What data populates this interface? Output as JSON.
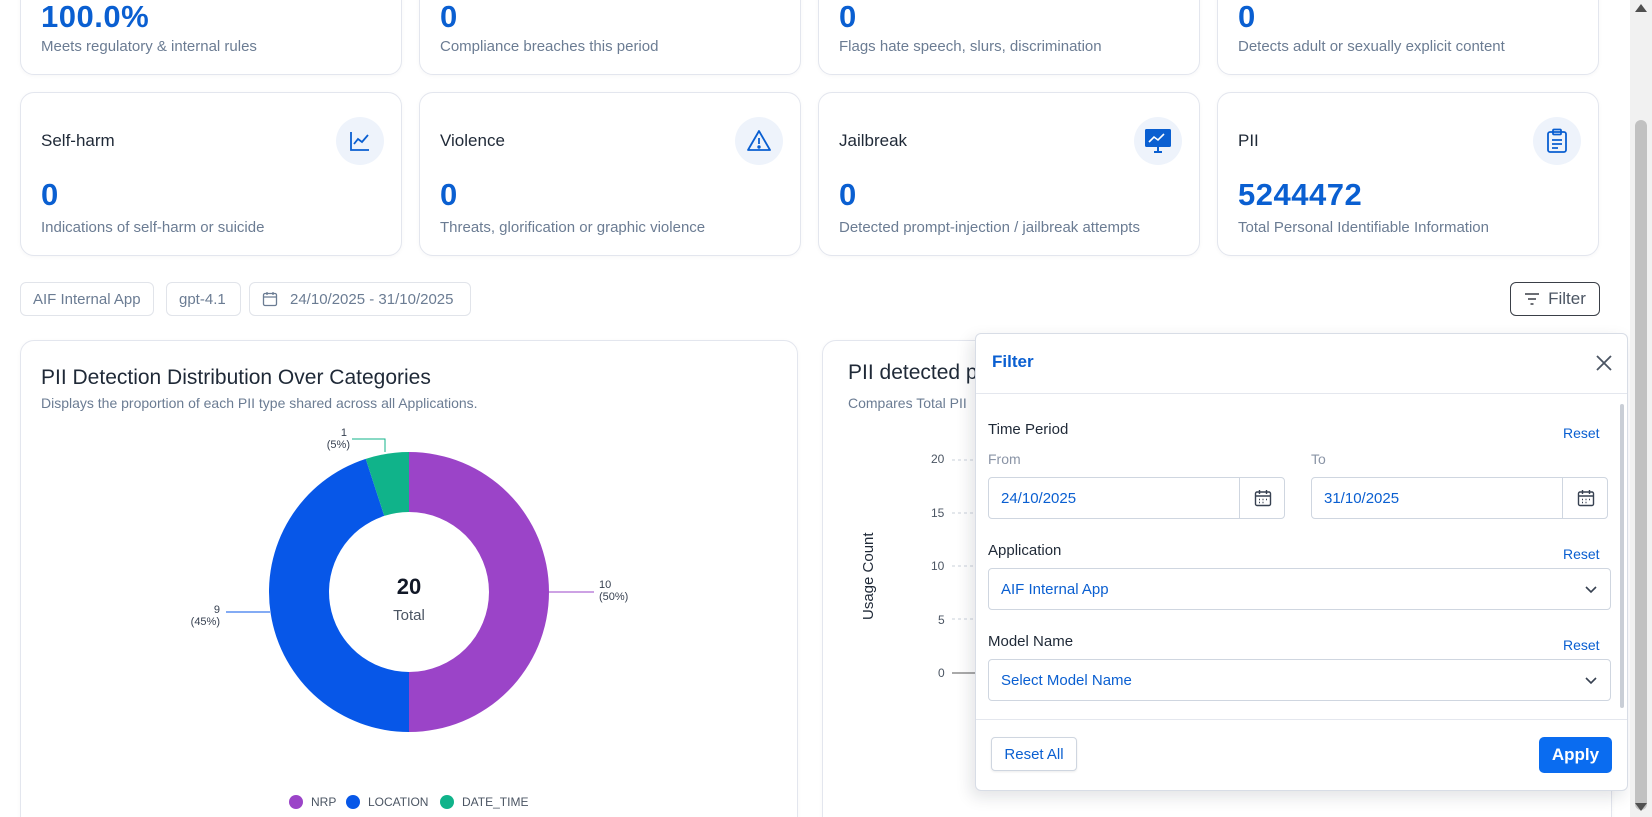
{
  "metrics_top": [
    {
      "value": "100.0%",
      "desc": "Meets regulatory & internal rules"
    },
    {
      "value": "0",
      "desc": "Compliance breaches this period"
    },
    {
      "value": "0",
      "desc": "Flags hate speech, slurs, discrimination"
    },
    {
      "value": "0",
      "desc": "Detects adult or sexually explicit content"
    }
  ],
  "metrics": [
    {
      "title": "Self-harm",
      "value": "0",
      "desc": "Indications of self-harm or suicide",
      "icon": "trend-line-chart-icon"
    },
    {
      "title": "Violence",
      "value": "0",
      "desc": "Threats, glorification or graphic violence",
      "icon": "warning-triangle-icon"
    },
    {
      "title": "Jailbreak",
      "value": "0",
      "desc": "Detected prompt-injection / jailbreak attempts",
      "icon": "monitor-icon"
    },
    {
      "title": "PII",
      "value": "5244472",
      "desc": "Total Personal Identifiable Information",
      "icon": "clipboard-icon"
    }
  ],
  "filters_bar": {
    "app": "AIF Internal App",
    "model": "gpt-4.1",
    "date_range": "24/10/2025 - 31/10/2025",
    "filter_label": "Filter"
  },
  "donut_card": {
    "title": "PII Detection Distribution Over Categories",
    "subtitle": "Displays the proportion of each PII type shared across all Applications.",
    "center_value": "20",
    "center_label": "Total",
    "labels": {
      "nrp": "10",
      "nrp_pct": "(50%)",
      "location": "9",
      "location_pct": "(45%)",
      "date_time": "1",
      "date_time_pct": "(5%)"
    }
  },
  "chart_data": {
    "type": "pie",
    "categories": [
      "NRP",
      "LOCATION",
      "DATE_TIME"
    ],
    "values": [
      10,
      9,
      1
    ],
    "colors": [
      "#9b44c8",
      "#0757e8",
      "#10b38a"
    ],
    "total": 20
  },
  "second_card": {
    "title_partial": "PII detected p",
    "subtitle_partial": "Compares Total PII",
    "ylabel": "Usage Count",
    "yticks": [
      "20",
      "15",
      "10",
      "5",
      "0"
    ]
  },
  "filter_panel": {
    "title": "Filter",
    "time_period_label": "Time Period",
    "reset_label": "Reset",
    "from_label": "From",
    "to_label": "To",
    "from_value": "24/10/2025",
    "to_value": "31/10/2025",
    "application_label": "Application",
    "application_value": "AIF Internal App",
    "model_label": "Model Name",
    "model_placeholder": "Select Model Name",
    "reset_all_label": "Reset All",
    "apply_label": "Apply"
  }
}
